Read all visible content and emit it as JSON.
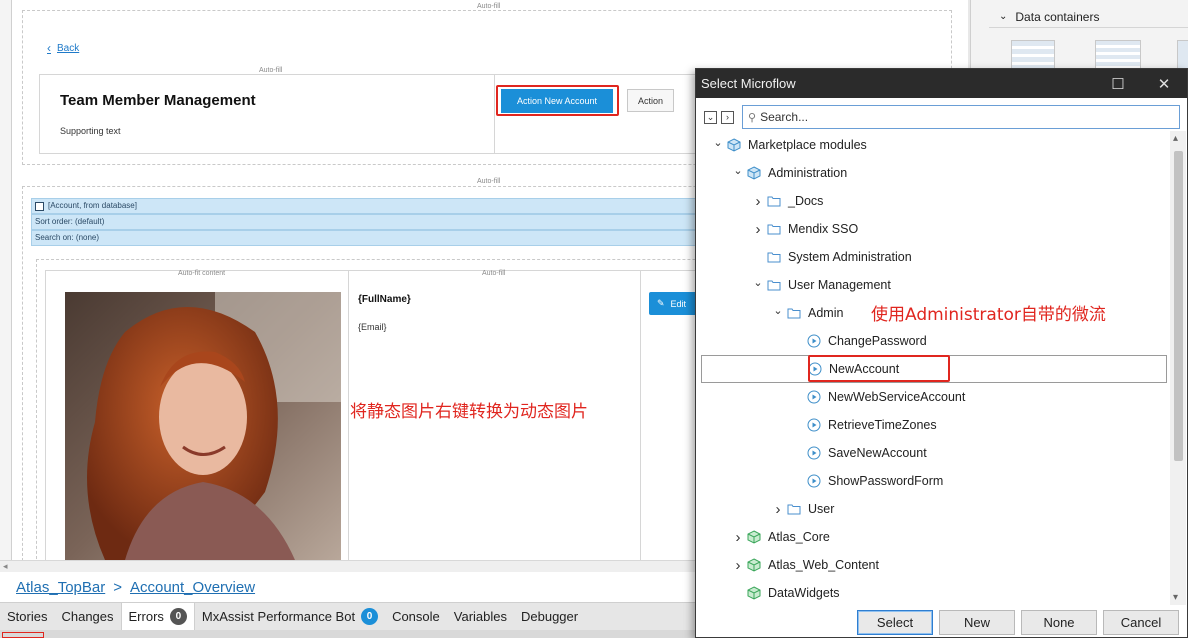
{
  "canvas": {
    "autofill_label": "Auto-fill",
    "autofit_content_label": "Auto-fit content",
    "back_label": "Back",
    "header_title": "Team Member Management",
    "header_support": "Supporting text",
    "action_new_account_label": "Action New Account",
    "action_label": "Action",
    "datasource_lines": [
      "[Account, from database]",
      "Sort order: (default)",
      "Search on: (none)"
    ],
    "full_name": "{FullName}",
    "email": "{Email}",
    "edit_label": "Edit",
    "annotation_image": "将静态图片右键转换为动态图片"
  },
  "toolbox": {
    "section_label": "Data containers"
  },
  "breadcrumb": {
    "items": [
      "Atlas_TopBar",
      "Account_Overview"
    ],
    "separator": ">"
  },
  "bottom_tabs": [
    {
      "label": "Stories"
    },
    {
      "label": "Changes"
    },
    {
      "label": "Errors",
      "count": "0",
      "active": true
    },
    {
      "label": "MxAssist Performance Bot",
      "count": "0"
    },
    {
      "label": "Console"
    },
    {
      "label": "Variables"
    },
    {
      "label": "Debugger"
    }
  ],
  "dialog": {
    "title": "Select Microflow",
    "search_placeholder": "Search...",
    "annotation_admin": "使用Administrator自带的微流",
    "tree": [
      {
        "label": "Marketplace modules",
        "depth": 0,
        "arrow": "down",
        "icon": "module"
      },
      {
        "label": "Administration",
        "depth": 1,
        "arrow": "down",
        "icon": "module"
      },
      {
        "label": "_Docs",
        "depth": 2,
        "arrow": "right",
        "icon": "folder"
      },
      {
        "label": "Mendix SSO",
        "depth": 2,
        "arrow": "right",
        "icon": "folder"
      },
      {
        "label": "System Administration",
        "depth": 2,
        "arrow": "none",
        "icon": "folder"
      },
      {
        "label": "User Management",
        "depth": 2,
        "arrow": "down",
        "icon": "folder"
      },
      {
        "label": "Admin",
        "depth": 3,
        "arrow": "down",
        "icon": "folder"
      },
      {
        "label": "ChangePassword",
        "depth": 4,
        "arrow": "none",
        "icon": "microflow"
      },
      {
        "label": "NewAccount",
        "depth": 4,
        "arrow": "none",
        "icon": "microflow",
        "selected": true
      },
      {
        "label": "NewWebServiceAccount",
        "depth": 4,
        "arrow": "none",
        "icon": "microflow"
      },
      {
        "label": "RetrieveTimeZones",
        "depth": 4,
        "arrow": "none",
        "icon": "microflow"
      },
      {
        "label": "SaveNewAccount",
        "depth": 4,
        "arrow": "none",
        "icon": "microflow"
      },
      {
        "label": "ShowPasswordForm",
        "depth": 4,
        "arrow": "none",
        "icon": "microflow"
      },
      {
        "label": "User",
        "depth": 3,
        "arrow": "right",
        "icon": "folder"
      },
      {
        "label": "Atlas_Core",
        "depth": 1,
        "arrow": "right",
        "icon": "module-green"
      },
      {
        "label": "Atlas_Web_Content",
        "depth": 1,
        "arrow": "right",
        "icon": "module-green"
      },
      {
        "label": "DataWidgets",
        "depth": 1,
        "arrow": "none",
        "icon": "module-green"
      }
    ],
    "buttons": {
      "select": "Select",
      "new": "New",
      "none": "None",
      "cancel": "Cancel"
    }
  },
  "colors": {
    "accent": "#1b8fd8",
    "highlight": "#e0261f",
    "badge": "#1b8fd8",
    "badge_dark": "#555555"
  }
}
